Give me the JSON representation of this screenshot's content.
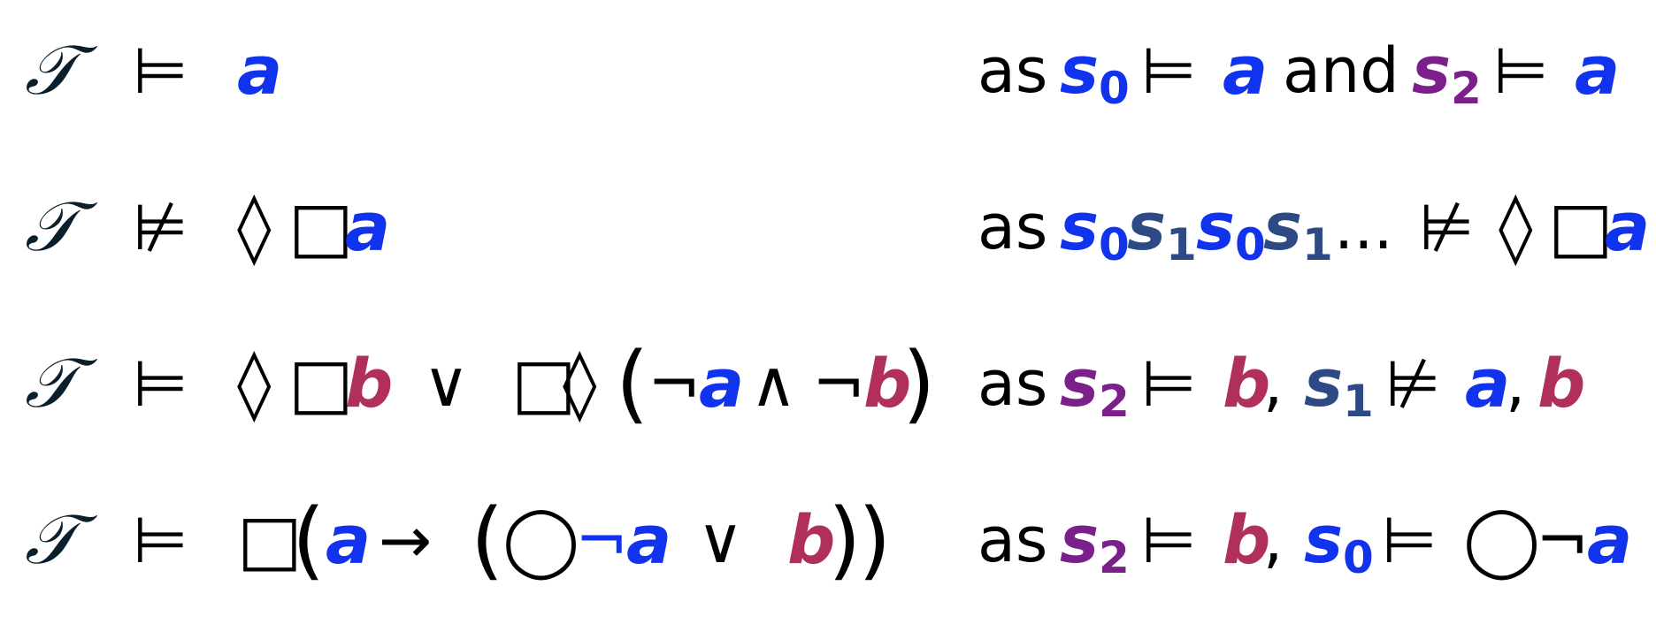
{
  "colors": {
    "a": "#1133ee",
    "b": "#b0305a",
    "s0": "#1133ee",
    "s1": "#2e4a85",
    "s2": "#7b1f8a"
  },
  "symbols": {
    "T": "𝒯",
    "models": "⊨",
    "not_models": "⊭",
    "diamond": "◊",
    "box": "□",
    "next": "◯",
    "not": "¬",
    "and": "∧",
    "or": "∨",
    "implies": "→",
    "comma": ",",
    "ellipsis": "...",
    "lparen": "(",
    "rparen": ")"
  },
  "vars": {
    "a": "a",
    "b": "b",
    "s": "s"
  },
  "subs": {
    "zero": "0",
    "one": "1",
    "two": "2"
  },
  "text": {
    "as": "as",
    "and": "and"
  }
}
